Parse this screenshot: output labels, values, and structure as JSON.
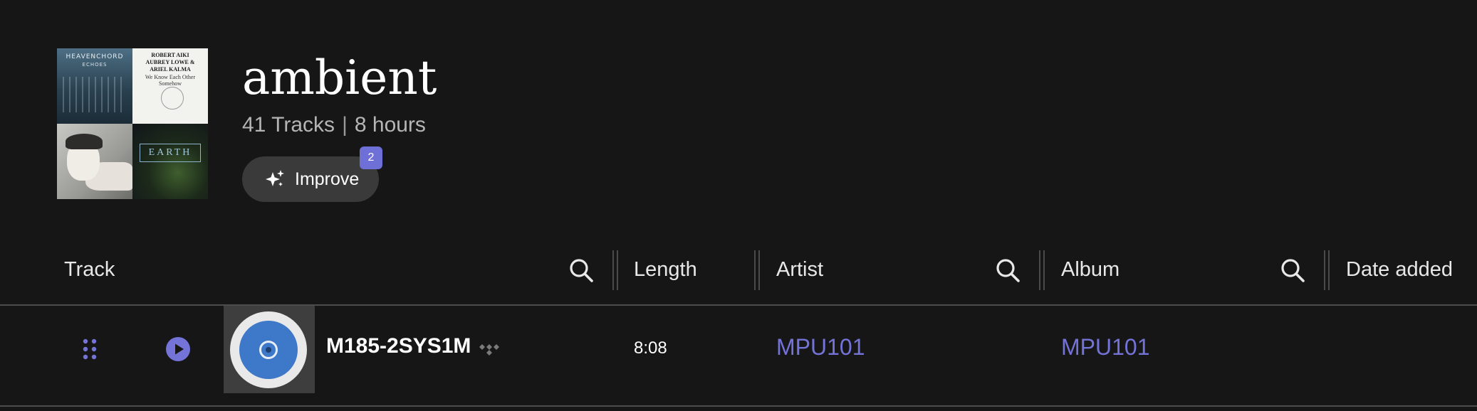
{
  "playlist": {
    "title": "ambient",
    "track_count": "41 Tracks",
    "separator": "|",
    "duration": "8 hours"
  },
  "cover": {
    "tile1_title": "HEAVENCHORD",
    "tile1_sub": "ECHOES",
    "tile2_line1": "ROBERT AIKI",
    "tile2_line2": "AUBREY LOWE &",
    "tile2_line3": "ARIEL KALMA",
    "tile2_line4": "We Know Each Other",
    "tile2_line5": "Somehow",
    "tile4_title": "EARTH"
  },
  "improve": {
    "label": "Improve",
    "badge": "2"
  },
  "columns": {
    "track": "Track",
    "length": "Length",
    "artist": "Artist",
    "album": "Album",
    "date_added": "Date added"
  },
  "tracks": [
    {
      "name": "M185-2SYS1M",
      "length": "8:08",
      "artist": "MPU101",
      "album": "MPU101"
    }
  ],
  "colors": {
    "background": "#161616",
    "accent": "#7373d8",
    "badge": "#6f6fd8",
    "button": "#3a3a3a"
  },
  "icons": {
    "improve": "sparkles-icon",
    "search": "search-icon",
    "drag": "drag-handle-icon",
    "play": "play-icon",
    "source": "tidal-icon"
  }
}
